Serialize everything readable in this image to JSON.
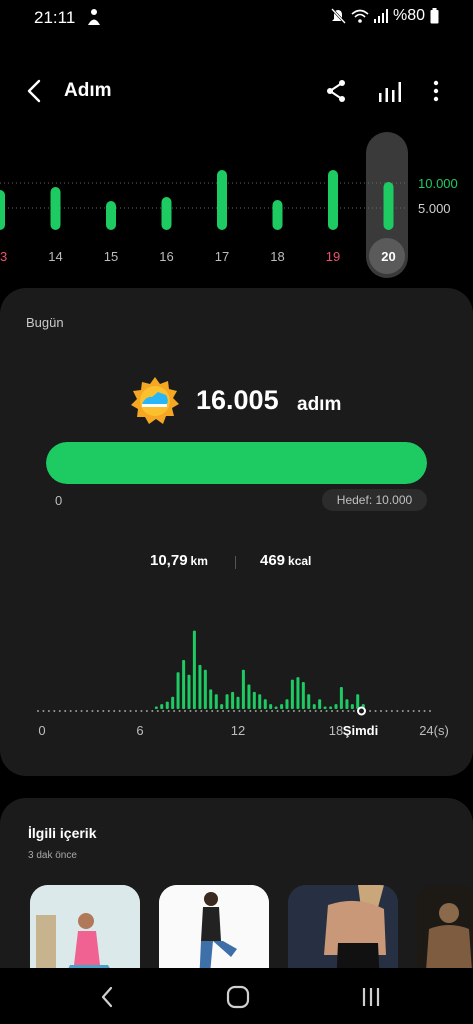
{
  "status_bar": {
    "time": "21:11",
    "battery_text": "%80",
    "icons": [
      "person-notification-icon",
      "mute-icon",
      "wifi-icon",
      "signal-icon",
      "battery-icon"
    ]
  },
  "app_bar": {
    "title": "Adım",
    "icons": [
      "back-arrow-icon",
      "share-icon",
      "bar-chart-icon",
      "more-vertical-icon"
    ]
  },
  "weekly_chart": {
    "days": [
      {
        "label": "13",
        "steps": 8000,
        "color": "#f0506e"
      },
      {
        "label": "14",
        "steps": 8600,
        "color": "#bdbdbd"
      },
      {
        "label": "15",
        "steps": 5800,
        "color": "#bdbdbd"
      },
      {
        "label": "16",
        "steps": 6600,
        "color": "#bdbdbd"
      },
      {
        "label": "17",
        "steps": 12000,
        "color": "#bdbdbd"
      },
      {
        "label": "18",
        "steps": 6000,
        "color": "#bdbdbd"
      },
      {
        "label": "19",
        "steps": 12000,
        "color": "#f0506e"
      },
      {
        "label": "20",
        "steps": 16005,
        "color": "#ffffff",
        "selected": true
      }
    ],
    "goal_labels": [
      {
        "text": "10.000",
        "value": 10000,
        "color": "#1ecb63"
      },
      {
        "text": "5.000",
        "value": 5000,
        "color": "#d0d0d0"
      }
    ],
    "bar_color": "#1ecb63"
  },
  "today": {
    "label": "Bugün",
    "steps": "16.005",
    "steps_unit": "adım",
    "progress_fraction": 1.0,
    "progress_min": "0",
    "goal": "Hedef: 10.000",
    "distance": "10,79",
    "distance_unit": "km",
    "calories": "469",
    "calories_unit": "kcal",
    "accent_color": "#1ecb63"
  },
  "chart_data": {
    "type": "bar",
    "xlabel": "",
    "ylabel": "",
    "xlim": [
      0,
      24
    ],
    "x_ticks": [
      {
        "value": 0,
        "label": "0"
      },
      {
        "value": 6,
        "label": "6"
      },
      {
        "value": 12,
        "label": "12"
      },
      {
        "value": 18,
        "label": "18"
      },
      {
        "value": 19.5,
        "label": "Şimdi",
        "bold": true
      },
      {
        "value": 24,
        "label": "24(s)"
      }
    ],
    "series": [
      {
        "values": [
          {
            "x": 7.0,
            "y": 1
          },
          {
            "x": 7.33,
            "y": 2
          },
          {
            "x": 7.67,
            "y": 3
          },
          {
            "x": 8.0,
            "y": 5
          },
          {
            "x": 8.33,
            "y": 15
          },
          {
            "x": 8.67,
            "y": 20
          },
          {
            "x": 9.0,
            "y": 14
          },
          {
            "x": 9.33,
            "y": 32
          },
          {
            "x": 9.67,
            "y": 18
          },
          {
            "x": 10.0,
            "y": 16
          },
          {
            "x": 10.33,
            "y": 8
          },
          {
            "x": 10.67,
            "y": 6
          },
          {
            "x": 11.0,
            "y": 2
          },
          {
            "x": 11.33,
            "y": 6
          },
          {
            "x": 11.67,
            "y": 7
          },
          {
            "x": 12.0,
            "y": 5
          },
          {
            "x": 12.33,
            "y": 16
          },
          {
            "x": 12.67,
            "y": 10
          },
          {
            "x": 13.0,
            "y": 7
          },
          {
            "x": 13.33,
            "y": 6
          },
          {
            "x": 13.67,
            "y": 4
          },
          {
            "x": 14.0,
            "y": 2
          },
          {
            "x": 14.33,
            "y": 1
          },
          {
            "x": 14.67,
            "y": 2
          },
          {
            "x": 15.0,
            "y": 4
          },
          {
            "x": 15.33,
            "y": 12
          },
          {
            "x": 15.67,
            "y": 13
          },
          {
            "x": 16.0,
            "y": 11
          },
          {
            "x": 16.33,
            "y": 6
          },
          {
            "x": 16.67,
            "y": 2
          },
          {
            "x": 17.0,
            "y": 4
          },
          {
            "x": 17.33,
            "y": 1
          },
          {
            "x": 17.67,
            "y": 1
          },
          {
            "x": 18.0,
            "y": 2
          },
          {
            "x": 18.33,
            "y": 9
          },
          {
            "x": 18.67,
            "y": 4
          },
          {
            "x": 19.0,
            "y": 2
          },
          {
            "x": 19.33,
            "y": 6
          },
          {
            "x": 19.67,
            "y": 2
          }
        ]
      }
    ],
    "grid": false
  },
  "related": {
    "title": "İlgili içerik",
    "time": "3 dak önce",
    "thumbs": [
      {
        "name": "yoga-woman-thumbnail"
      },
      {
        "name": "stretching-woman-thumbnail"
      },
      {
        "name": "back-muscle-woman-thumbnail"
      },
      {
        "name": "muscular-man-thumbnail"
      }
    ]
  },
  "nav_bar": {
    "icons": [
      "nav-back-icon",
      "nav-home-icon",
      "nav-recents-icon"
    ]
  }
}
